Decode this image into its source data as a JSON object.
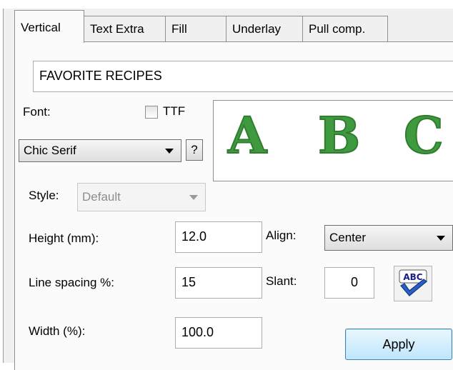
{
  "tabs": [
    {
      "label": "Vertical",
      "active": true
    },
    {
      "label": "Text Extra",
      "active": false
    },
    {
      "label": "Fill",
      "active": false
    },
    {
      "label": "Underlay",
      "active": false
    },
    {
      "label": "Pull comp.",
      "active": false
    }
  ],
  "text_field": {
    "value": "FAVORITE RECIPES"
  },
  "font": {
    "label": "Font:",
    "ttf_label": "TTF",
    "ttf_checked": false,
    "selected": "Chic Serif",
    "help_label": "?"
  },
  "preview": {
    "letters": [
      "A",
      "B",
      "C"
    ],
    "color": "#3f9a3f"
  },
  "style": {
    "label": "Style:",
    "selected": "Default",
    "enabled": false
  },
  "height": {
    "label": "Height (mm):",
    "value": "12.0"
  },
  "align": {
    "label": "Align:",
    "selected": "Center"
  },
  "line_spacing": {
    "label": "Line spacing %:",
    "value": "15"
  },
  "slant": {
    "label": "Slant:",
    "value": "0"
  },
  "width": {
    "label": "Width (%):",
    "value": "100.0"
  },
  "spell_icon": {
    "text": "ABC",
    "name": "spell-check-icon"
  },
  "apply_button": {
    "label": "Apply"
  }
}
